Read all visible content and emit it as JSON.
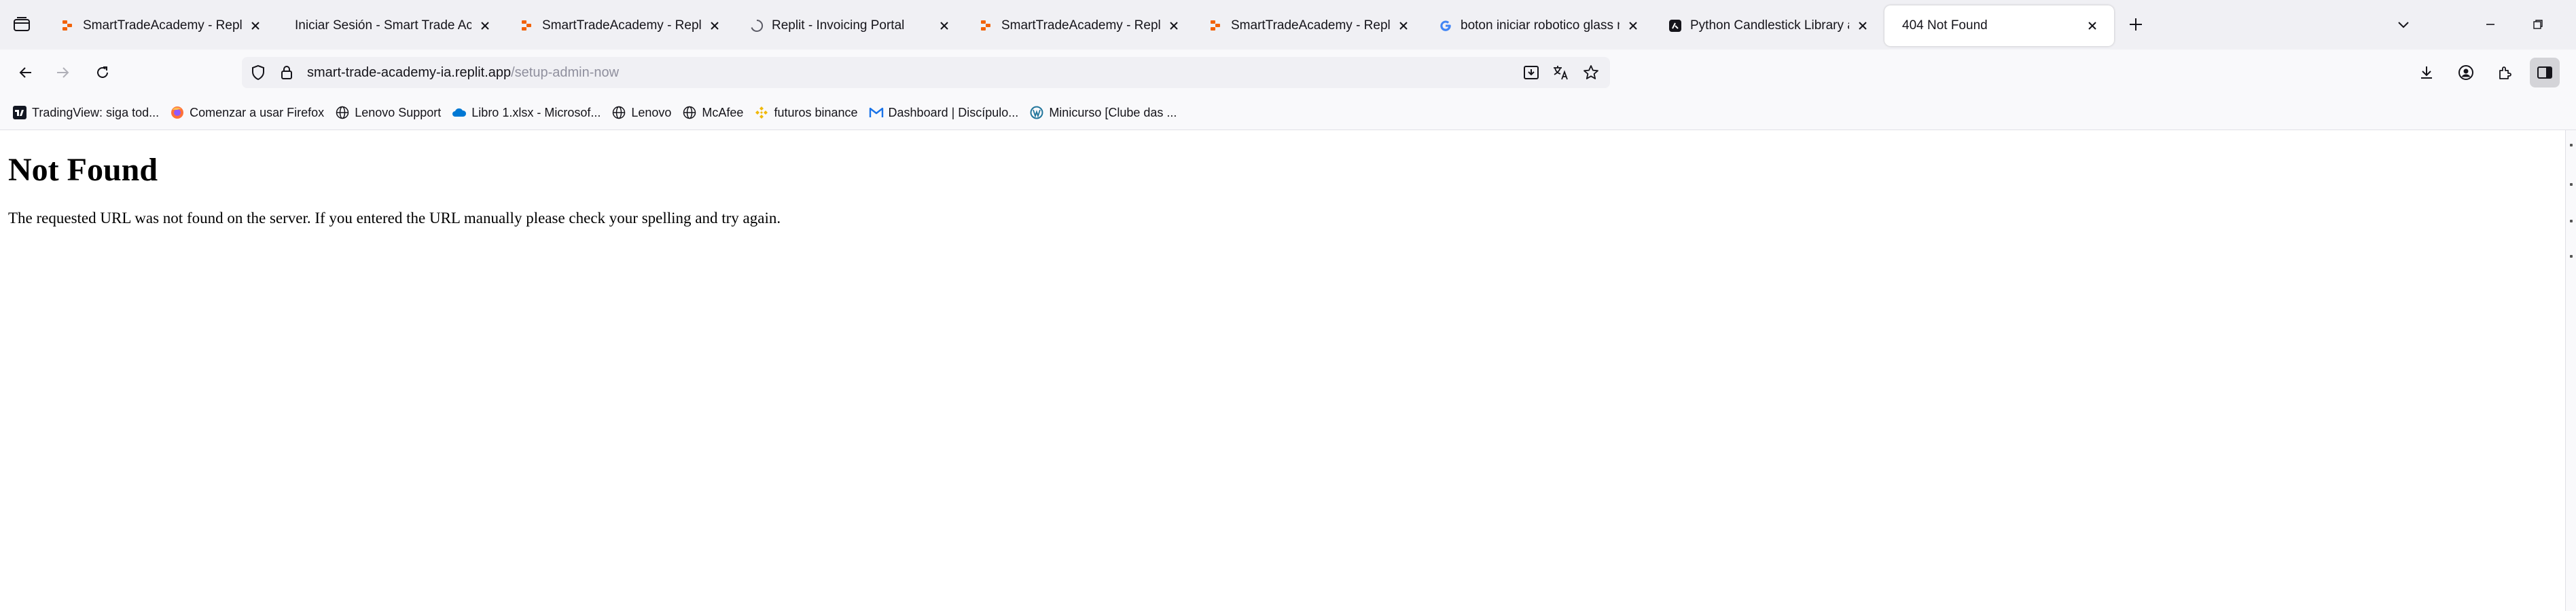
{
  "tabs": [
    {
      "title": "SmartTradeAcademy - Replit",
      "favicon": "replit-icon",
      "active": false
    },
    {
      "title": "Iniciar Sesión - Smart Trade Academy",
      "favicon": "",
      "active": false
    },
    {
      "title": "SmartTradeAcademy - Replit",
      "favicon": "replit-icon",
      "active": false
    },
    {
      "title": "Replit - Invoicing Portal",
      "favicon": "loading-spinner-icon",
      "active": false
    },
    {
      "title": "SmartTradeAcademy - Replit",
      "favicon": "replit-icon",
      "active": false
    },
    {
      "title": "SmartTradeAcademy - Replit",
      "favicon": "replit-icon",
      "active": false
    },
    {
      "title": "boton iniciar robotico glass mo",
      "favicon": "google-icon",
      "active": false
    },
    {
      "title": "Python Candlestick Library and",
      "favicon": "app-icon",
      "active": false
    },
    {
      "title": "404 Not Found",
      "favicon": "",
      "active": true
    }
  ],
  "urlbar": {
    "domain": "smart-trade-academy-ia.replit.app",
    "path": "/setup-admin-now"
  },
  "bookmarks": [
    {
      "label": "TradingView: siga tod...",
      "icon": "tradingview-icon"
    },
    {
      "label": "Comenzar a usar Firefox",
      "icon": "firefox-icon"
    },
    {
      "label": "Lenovo Support",
      "icon": "globe-icon"
    },
    {
      "label": "Libro 1.xlsx - Microsof...",
      "icon": "onedrive-icon"
    },
    {
      "label": "Lenovo",
      "icon": "globe-icon"
    },
    {
      "label": "McAfee",
      "icon": "globe-icon"
    },
    {
      "label": "futuros binance",
      "icon": "binance-icon"
    },
    {
      "label": "Dashboard | Discípulo...",
      "icon": "gmail-icon"
    },
    {
      "label": "Minicurso [Clube das ...",
      "icon": "wordpress-icon"
    }
  ],
  "page": {
    "heading": "Not Found",
    "message": "The requested URL was not found on the server. If you entered the URL manually please check your spelling and try again."
  },
  "colors": {
    "replit_orange": "#f26207",
    "toolbar_bg": "#f9f9fb",
    "tabstrip_bg": "#f0f0f4",
    "url_path_gray": "#8f8f9d"
  }
}
